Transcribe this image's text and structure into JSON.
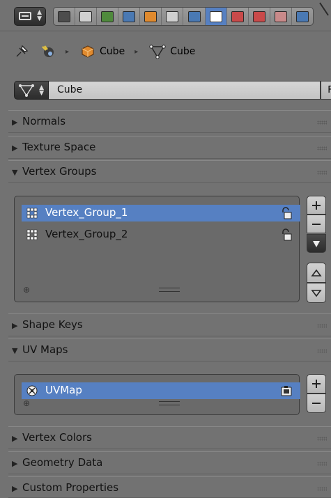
{
  "context_tabs": [
    {
      "name": "render-tab",
      "icon": "camera-icon",
      "color": "#4d4d4d",
      "active": false
    },
    {
      "name": "render-layers-tab",
      "icon": "render-layers-icon",
      "color": "#d0d0d0",
      "active": false
    },
    {
      "name": "scene-tab",
      "icon": "scene-icon",
      "color": "#4f8a3c",
      "active": false
    },
    {
      "name": "world-tab",
      "icon": "world-icon",
      "color": "#4a79b3",
      "active": false
    },
    {
      "name": "object-tab",
      "icon": "object-cube-icon",
      "color": "#e08a2e",
      "active": false
    },
    {
      "name": "constraints-tab",
      "icon": "constraint-link-icon",
      "color": "#d0d0d0",
      "active": false
    },
    {
      "name": "modifiers-tab",
      "icon": "wrench-icon",
      "color": "#4a79b3",
      "active": false
    },
    {
      "name": "data-tab",
      "icon": "mesh-data-icon",
      "color": "#ffffff",
      "active": true
    },
    {
      "name": "material-tab",
      "icon": "material-sphere-icon",
      "color": "#c94a4a",
      "active": false
    },
    {
      "name": "texture-tab",
      "icon": "texture-checker-icon",
      "color": "#c94a4a",
      "active": false
    },
    {
      "name": "particles-tab",
      "icon": "particles-icon",
      "color": "#c98a8a",
      "active": false
    },
    {
      "name": "physics-tab",
      "icon": "physics-icon",
      "color": "#4a79b3",
      "active": false
    }
  ],
  "breadcrumb": {
    "scene_icon": "scene-icon",
    "object_label": "Cube",
    "mesh_label": "Cube"
  },
  "datablock": {
    "name": "Cube",
    "fake_user_label": "F"
  },
  "panels": {
    "normals": "Normals",
    "texture_space": "Texture Space",
    "vertex_groups": "Vertex Groups",
    "shape_keys": "Shape Keys",
    "uv_maps": "UV Maps",
    "vertex_colors": "Vertex Colors",
    "geometry_data": "Geometry Data",
    "custom_properties": "Custom Properties"
  },
  "vertex_groups": [
    {
      "name": "Vertex_Group_1",
      "selected": true
    },
    {
      "name": "Vertex_Group_2",
      "selected": false
    }
  ],
  "uv_maps": [
    {
      "name": "UVMap",
      "selected": true
    }
  ],
  "colors": {
    "background": "#727272",
    "selection": "#5680c2",
    "active_tab": "#5680c2"
  }
}
